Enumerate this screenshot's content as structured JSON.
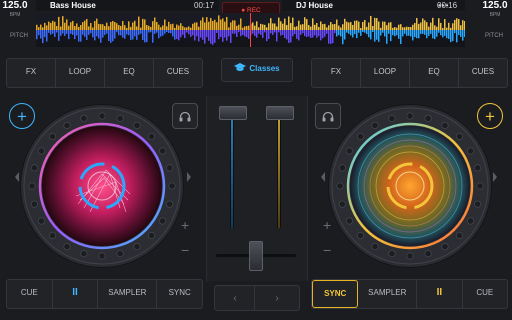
{
  "deck_left": {
    "bpm": "125.0",
    "bpm_unit": "BPM",
    "pitch_label": "PITCH",
    "title": "Bass House",
    "time": "00:17",
    "menu": "•••",
    "tabs": [
      "FX",
      "LOOP",
      "EQ",
      "CUES"
    ],
    "transport": [
      "CUE",
      "II",
      "SAMPLER",
      "SYNC"
    ],
    "plus": "+",
    "minus": "−",
    "accent": "#3fb6ff"
  },
  "deck_right": {
    "bpm": "125.0",
    "bpm_unit": "BPM",
    "pitch_label": "PITCH",
    "title": "DJ House",
    "time": "00:16",
    "menu": "•••",
    "tabs": [
      "FX",
      "LOOP",
      "EQ",
      "CUES"
    ],
    "transport": [
      "SYNC",
      "SAMPLER",
      "II",
      "CUE"
    ],
    "plus": "+",
    "minus": "−",
    "accent": "#f2c53a"
  },
  "recorder": {
    "label": "● REC",
    "color": "#ff4b4b"
  },
  "mixer": {
    "classes_label": "Classes",
    "prev": "‹",
    "next": "›"
  },
  "icons": {
    "headphones": "headphones-icon",
    "graduation_cap": "graduation-cap-icon",
    "add": "plus-icon"
  }
}
